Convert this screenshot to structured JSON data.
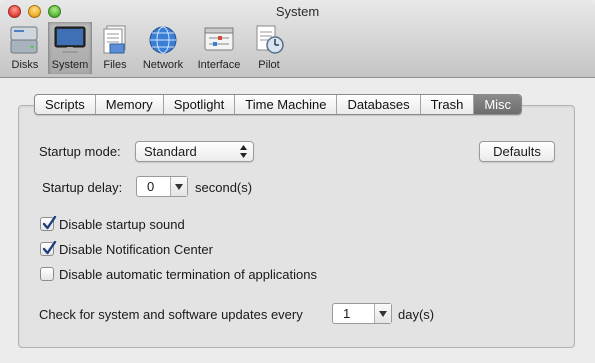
{
  "window": {
    "title": "System"
  },
  "toolbar": {
    "items": [
      {
        "label": "Disks",
        "icon": "disks-icon"
      },
      {
        "label": "System",
        "icon": "monitor-icon",
        "selected": true
      },
      {
        "label": "Files",
        "icon": "files-icon"
      },
      {
        "label": "Network",
        "icon": "globe-icon"
      },
      {
        "label": "Interface",
        "icon": "interface-icon"
      },
      {
        "label": "Pilot",
        "icon": "pilot-icon"
      }
    ]
  },
  "tabs": [
    {
      "label": "Scripts"
    },
    {
      "label": "Memory"
    },
    {
      "label": "Spotlight"
    },
    {
      "label": "Time Machine"
    },
    {
      "label": "Databases"
    },
    {
      "label": "Trash"
    },
    {
      "label": "Misc",
      "active": true
    }
  ],
  "misc": {
    "startup_mode_label": "Startup mode:",
    "startup_mode_value": "Standard",
    "defaults_button": "Defaults",
    "startup_delay_label": "Startup delay:",
    "startup_delay_value": "0",
    "startup_delay_unit": "second(s)",
    "checkboxes": [
      {
        "label": "Disable startup sound",
        "checked": true
      },
      {
        "label": "Disable Notification Center",
        "checked": true
      },
      {
        "label": "Disable automatic termination of applications",
        "checked": false
      }
    ],
    "update_check_label": "Check for system and software updates every",
    "update_check_value": "1",
    "update_check_unit": "day(s)"
  },
  "colors": {
    "accent_check": "#1f5fbf",
    "active_tab": "#7a7a7a"
  }
}
